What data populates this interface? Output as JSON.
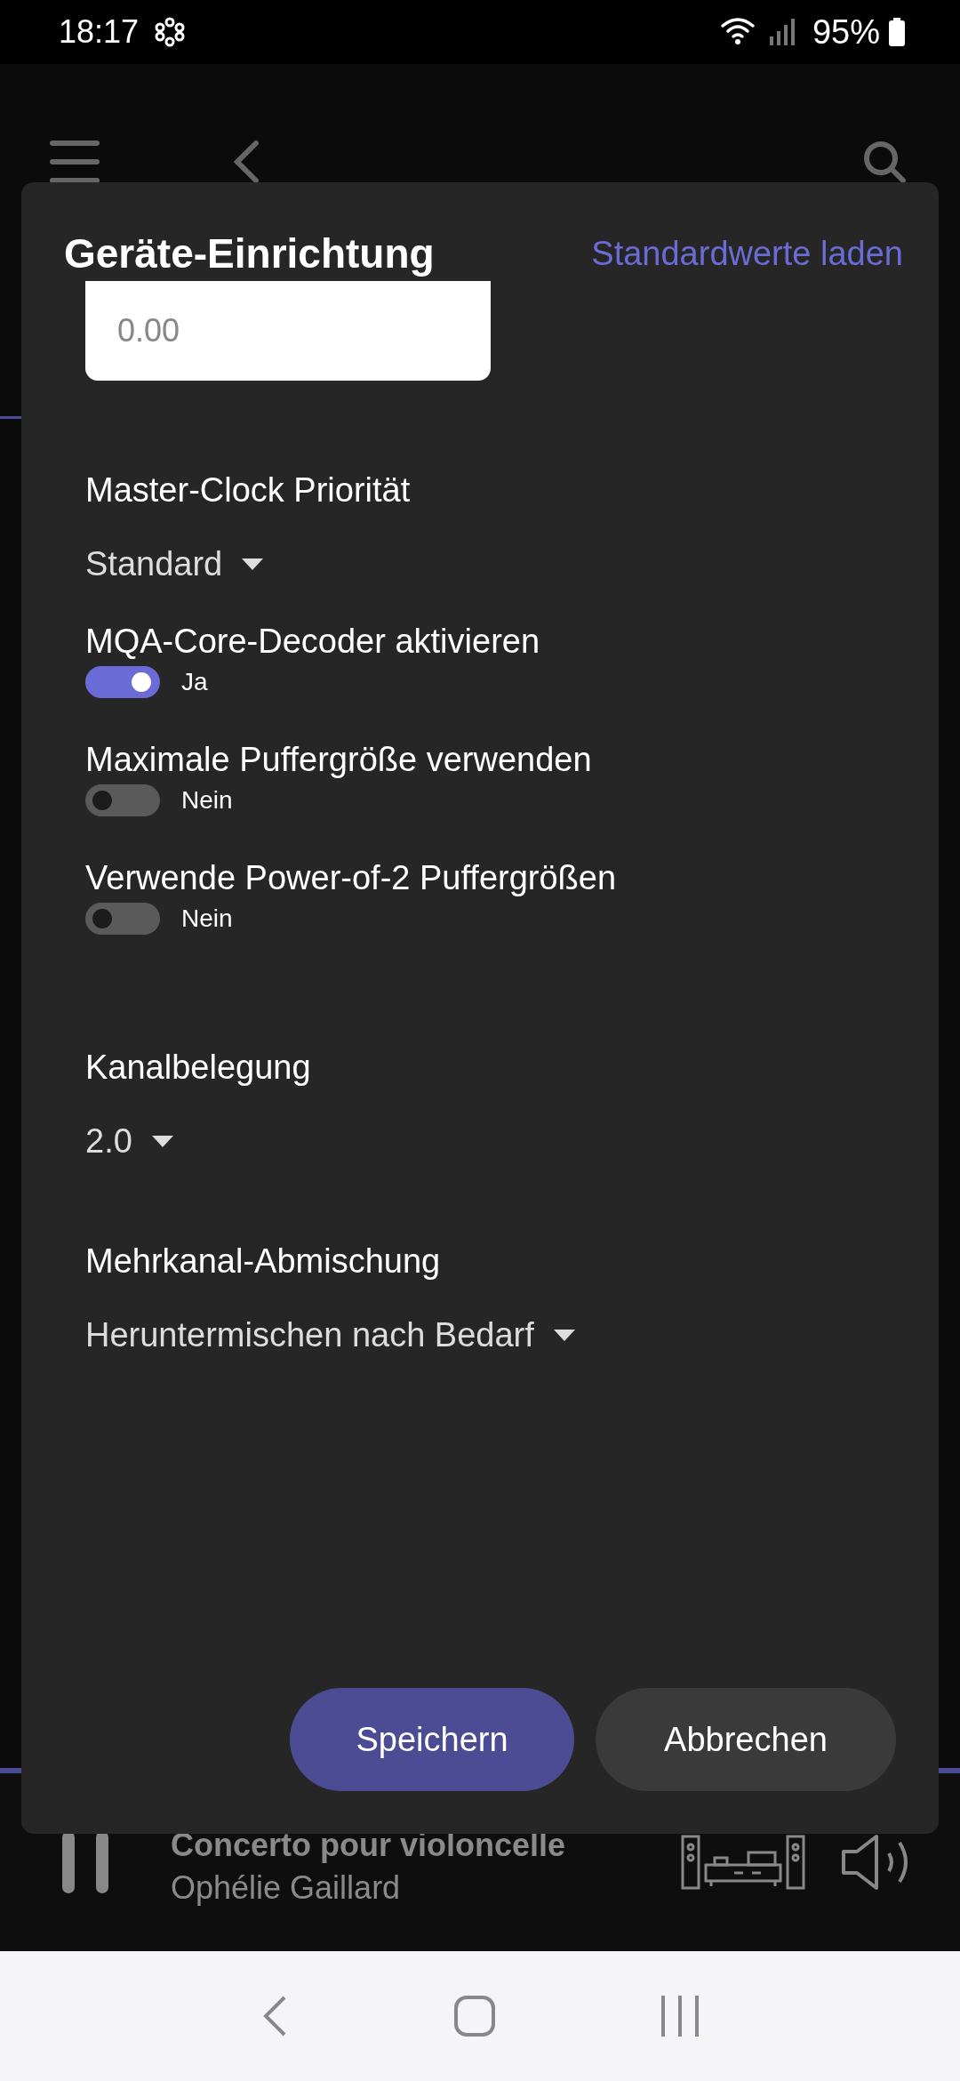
{
  "status_bar": {
    "time": "18:17",
    "battery": "95%"
  },
  "dialog": {
    "title": "Geräte-Einrichtung",
    "defaults_link": "Standardwerte laden",
    "value_field": {
      "placeholder": "0.00"
    },
    "settings": [
      {
        "kind": "dropdown",
        "label": "Master-Clock Priorität",
        "value": "Standard"
      },
      {
        "kind": "toggle",
        "label": "MQA-Core-Decoder aktivieren",
        "on": true,
        "state_text": "Ja"
      },
      {
        "kind": "toggle",
        "label": "Maximale Puffergröße verwenden",
        "on": false,
        "state_text": "Nein"
      },
      {
        "kind": "toggle",
        "label": "Verwende Power-of-2 Puffergrößen",
        "on": false,
        "state_text": "Nein"
      },
      {
        "kind": "dropdown",
        "label": "Kanalbelegung",
        "value": "2.0"
      },
      {
        "kind": "dropdown",
        "label": "Mehrkanal-Abmischung",
        "value": "Heruntermischen nach Bedarf"
      }
    ],
    "buttons": [
      {
        "label": "Speichern",
        "kind": "primary"
      },
      {
        "label": "Abbrechen",
        "kind": "secondary"
      }
    ]
  },
  "now_playing": {
    "title": "Concerto pour violoncelle",
    "artist": "Ophélie Gaillard"
  }
}
